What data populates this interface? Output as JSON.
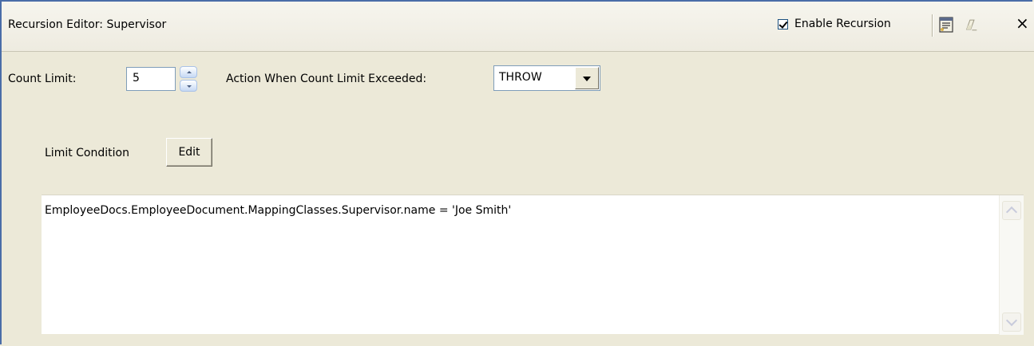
{
  "window": {
    "title": "Recursion Editor: Supervisor",
    "enable_recursion_label": "Enable Recursion",
    "enable_recursion_checked": true,
    "close_symbol": "×",
    "icons": [
      "properties-icon",
      "eraser-icon",
      "close-icon"
    ]
  },
  "count_limit": {
    "label": "Count Limit:",
    "value": "5"
  },
  "action": {
    "label": "Action When Count Limit Exceeded:",
    "selected": "THROW"
  },
  "limit_condition": {
    "label": "Limit Condition",
    "edit_label": "Edit",
    "expression": "EmployeeDocs.EmployeeDocument.MappingClasses.Supervisor.name = 'Joe Smith'"
  },
  "colors": {
    "panel_background": "#ECE9D8",
    "frame_border": "#4A6DA8"
  }
}
